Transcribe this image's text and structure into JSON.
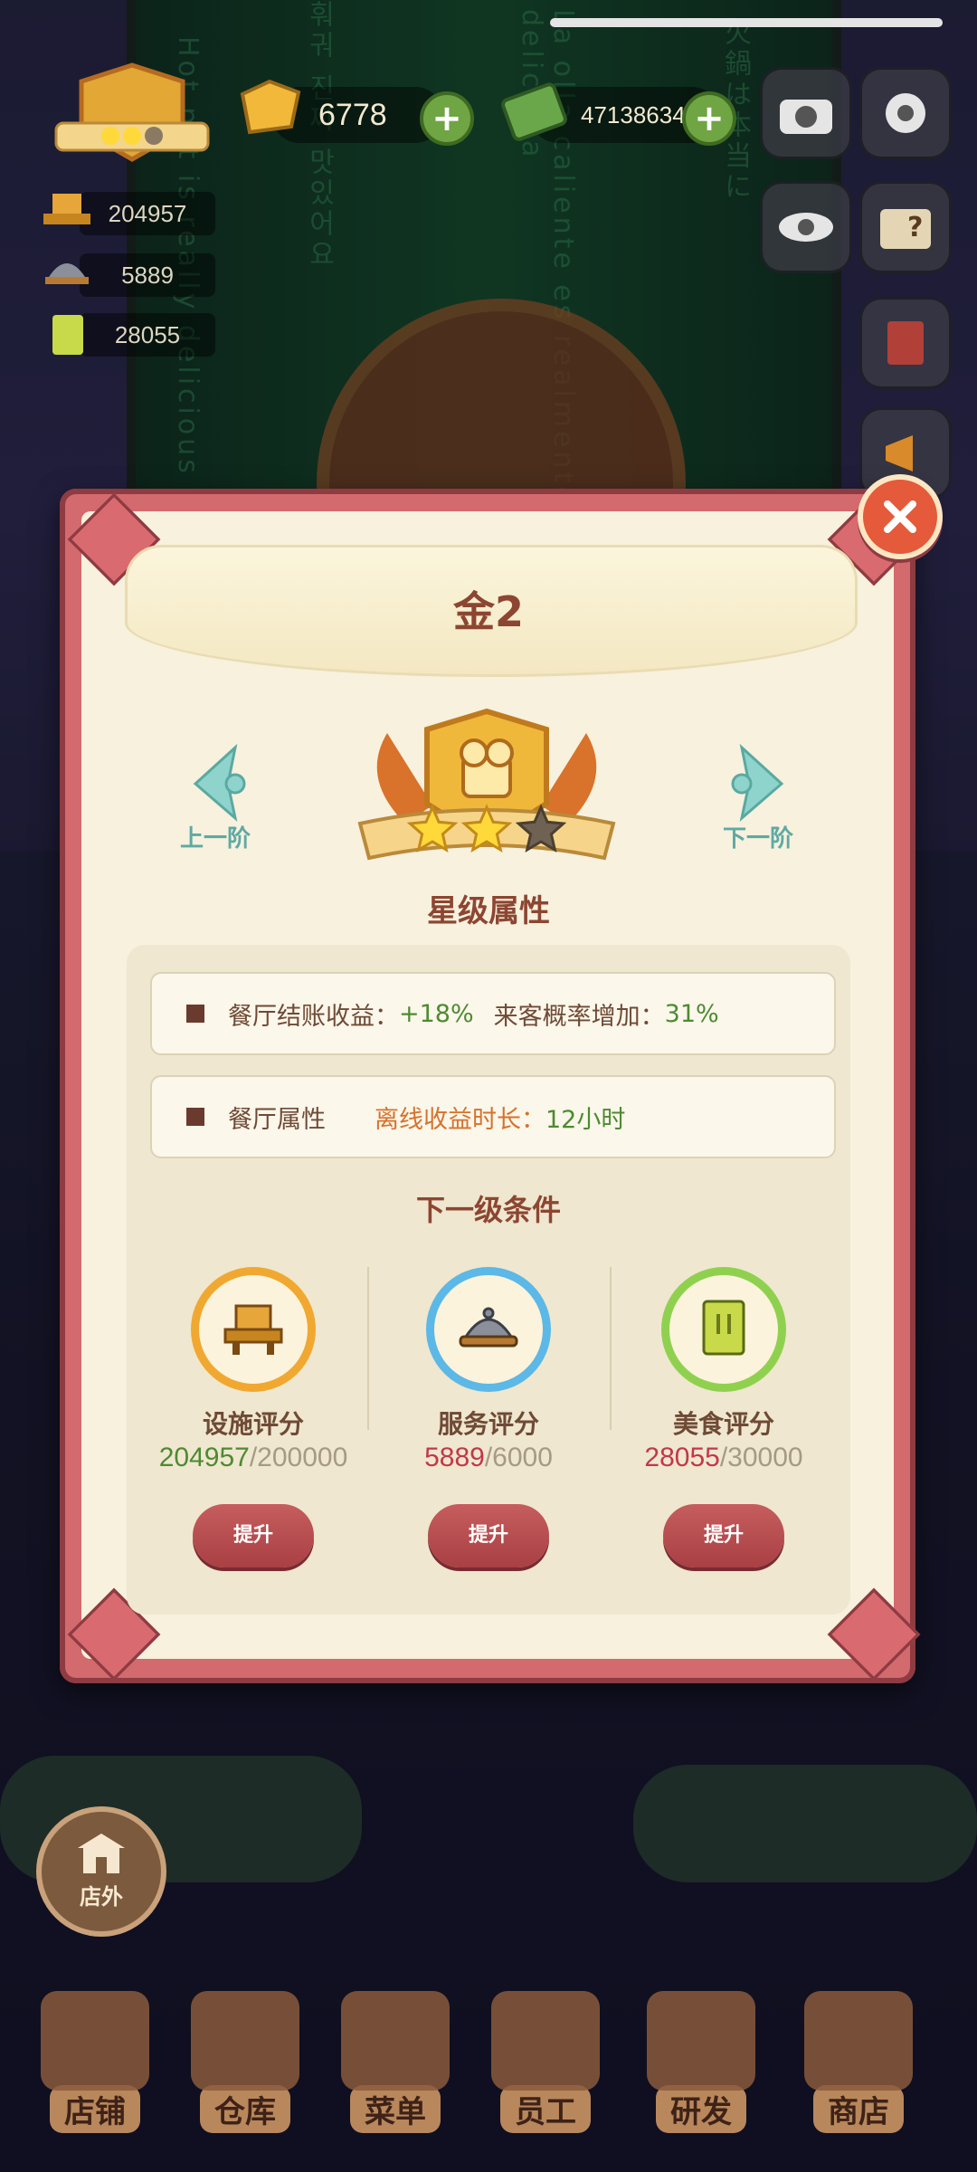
{
  "top_bar": {
    "gold": "6778",
    "cash": "47138634"
  },
  "stats": {
    "facility": "204957",
    "service": "5889",
    "food": "28055"
  },
  "billboard": {
    "lines": [
      "Hot pot is really delicious",
      "La olla caliente es realmente deliciosa",
      "훠궈 진짜 맛있어요",
      "火鍋は本当に"
    ]
  },
  "modal": {
    "title": "金2",
    "prev_label": "上一阶",
    "next_label": "下一阶",
    "stars_total": 3,
    "stars_earned": 2,
    "section_title": "星级属性",
    "attr_row1": {
      "label_a": "餐厅结账收益：",
      "value_a": "+18%",
      "label_b": "来客概率增加：",
      "value_b": "31%"
    },
    "attr_row2": {
      "label": "餐厅属性",
      "offline_label": "离线收益时长：",
      "offline_value": "12小时"
    },
    "next_title": "下一级条件",
    "conditions": [
      {
        "label": "设施评分",
        "current": "204957",
        "goal": "/200000",
        "ring_color": "#f0a830",
        "icon": "facility-icon"
      },
      {
        "label": "服务评分",
        "current": "5889",
        "goal": "/6000",
        "ring_color": "#5cb8e6",
        "icon": "service-icon"
      },
      {
        "label": "美食评分",
        "current": "28055",
        "goal": "/30000",
        "ring_color": "#8fd14f",
        "icon": "recipe-book-icon"
      }
    ],
    "upgrade_label": "提升"
  },
  "outside_label": "店外",
  "bottom_nav": [
    "店铺",
    "仓库",
    "菜单",
    "员工",
    "研发",
    "商店"
  ],
  "colors": {
    "modal_frame": "#d36a6e",
    "modal_bg": "#f7f1de",
    "title_brown": "#8c4632",
    "ok_green": "#4e8a32",
    "deficit_red": "#c2384a"
  }
}
